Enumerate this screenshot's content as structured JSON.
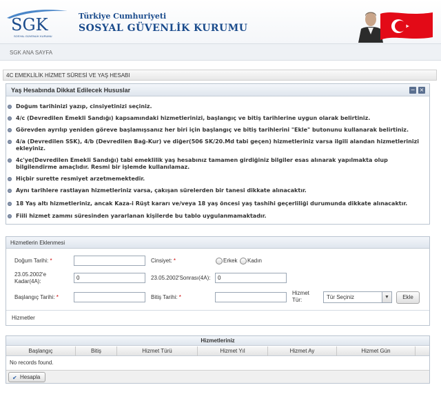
{
  "header": {
    "logo_text": "SGK",
    "logo_sub": "SOSYAL GÜVENLİK KURUMU",
    "title_small": "Türkiye Cumhuriyeti",
    "title_big": "SOSYAL GÜVENLİK KURUMU",
    "colors": {
      "brand": "#1a4b8c",
      "flag_red": "#e30a17"
    }
  },
  "nav": {
    "home": "SGK ANA SAYFA"
  },
  "page": {
    "title": "4C EMEKLİLİK HİZMET SÜRESİ VE YAŞ HESABI"
  },
  "info": {
    "title": "Yaş Hesabında Dikkat Edilecek Hususlar",
    "collapse_icon": "minus-icon",
    "close_icon": "close-icon",
    "items": [
      "Doğum tarihinizi yazıp, cinsiyetinizi seçiniz.",
      "4/c (Devredilen Emekli Sandığı) kapsamındaki hizmetlerinizi, başlangıç ve bitiş tarihlerine uygun olarak belirtiniz.",
      "Görevden ayrılıp yeniden göreve başlamışsanız her biri için başlangıç ve bitiş tarihlerini \"Ekle\" butonunu kullanarak belirtiniz.",
      "4/a (Devredilen SSK), 4/b (Devredilen Bağ-Kur) ve diğer(506 SK/20.Md tabi geçen) hizmetleriniz varsa ilgili alandan hizmetlerinizi ekleyiniz.",
      "4c'ye(Devredilen Emekli Sandığı) tabi emeklilik yaş hesabınız tamamen girdiğiniz bilgiler esas alınarak yapılmakta olup bilgilendirme amaçlıdır. Resmi bir işlemde kullanılamaz.",
      "Hiçbir surette resmiyet arzetmemektedir.",
      "Aynı tarihlere rastlayan hizmetleriniz varsa, çakışan sürelerden bir tanesi dikkate alınacaktır.",
      "18 Yaş altı hizmetleriniz, ancak Kaza-i Rüşt kararı ve/veya 18 yaş öncesi yaş tashihi geçerliliği durumunda dikkate alınacaktır.",
      "Fiili hizmet zammı süresinden yararlanan kişilerde bu tablo uygulanmamaktadır."
    ]
  },
  "form": {
    "title": "Hizmetlerin Eklenmesi",
    "dogum_label": "Doğum Tarihi:",
    "required_mark": "*",
    "dogum_value": "",
    "cinsiyet_label": "Cinsiyet:",
    "erkek": "Erkek",
    "kadin": "Kadın",
    "before_label_1": "23.05.2002'e",
    "before_label_2": "Kadar(4A):",
    "before_value": "0",
    "after_label": "23.05.2002'Sonrası(4A):",
    "after_value": "0",
    "baslangic_label": "Başlangıç Tarihi:",
    "baslangic_value": "",
    "bitis_label": "Bitiş Tarihi:",
    "bitis_value": "",
    "hizmet_turu_label_1": "Hizmet",
    "hizmet_turu_label_2": "Tür:",
    "hizmet_turu_selected": "Tür Seçiniz",
    "ekle_button": "Ekle",
    "hizmetler_label": "Hizmetler"
  },
  "grid": {
    "title": "Hizmetleriniz",
    "columns": [
      "Başlangıç",
      "Bitiş",
      "Hizmet Türü",
      "Hizmet Yıl",
      "Hizmet Ay",
      "Hizmet Gün"
    ],
    "empty_text": "No records found.",
    "calculate_button": "Hesapla"
  }
}
